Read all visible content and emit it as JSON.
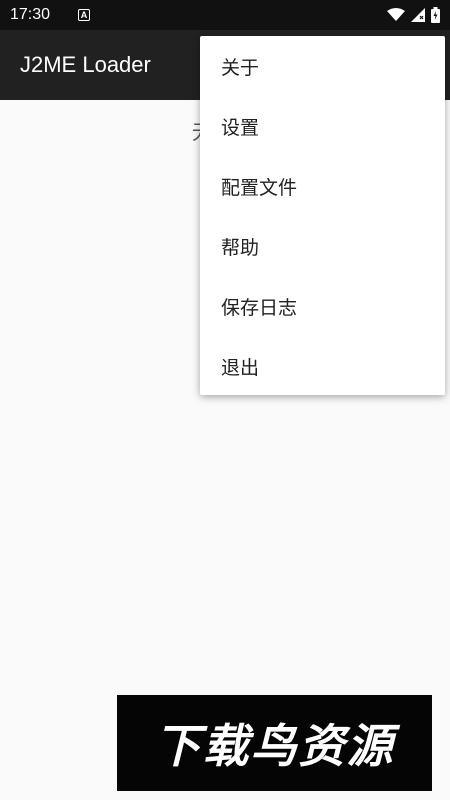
{
  "status_bar": {
    "time": "17:30",
    "notification_icon_letter": "A",
    "icons": [
      "wifi-icon",
      "signal-icon",
      "battery-icon"
    ]
  },
  "app_bar": {
    "title": "J2ME Loader"
  },
  "main": {
    "empty_text_partial": "无"
  },
  "overflow_menu": {
    "items": [
      {
        "label": "关于"
      },
      {
        "label": "设置"
      },
      {
        "label": "配置文件"
      },
      {
        "label": "帮助"
      },
      {
        "label": "保存日志"
      },
      {
        "label": "退出"
      }
    ]
  },
  "watermark": {
    "text": "下载鸟资源"
  },
  "colors": {
    "status_bar": "#111111",
    "app_bar": "#212121",
    "background": "#fafafa",
    "menu_background": "#ffffff"
  }
}
